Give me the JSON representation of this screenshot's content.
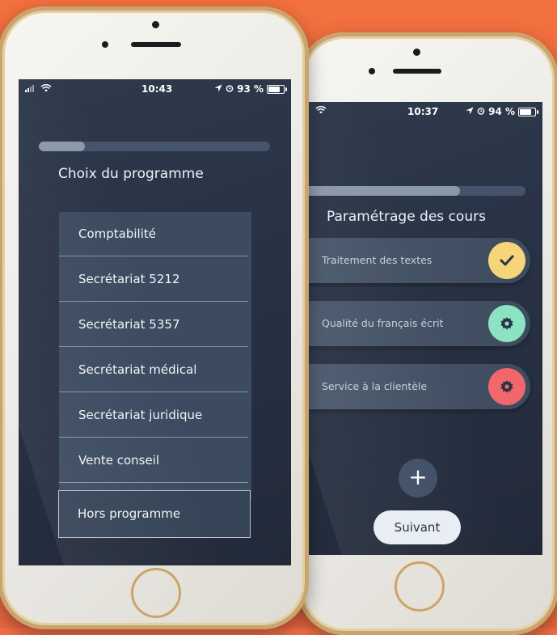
{
  "left_phone": {
    "status": {
      "time": "10:43",
      "battery": "93 %",
      "battery_level": 0.93
    },
    "progress": 0.2,
    "title": "Choix du programme",
    "programs": [
      "Comptabilité",
      "Secrétariat 5212",
      "Secrétariat 5357",
      "Secrétariat médical",
      "Secrétariat juridique",
      "Vente conseil"
    ],
    "other_program": "Hors programme"
  },
  "right_phone": {
    "status": {
      "time": "10:37",
      "battery": "94 %",
      "battery_level": 0.94
    },
    "progress": 0.7,
    "title": "Paramétrage des cours",
    "courses": [
      {
        "label": "Traitement des textes",
        "icon": "check-icon",
        "color": "#f6d57a"
      },
      {
        "label": "Qualité du français écrit",
        "icon": "gear-icon",
        "color": "#8be3c3"
      },
      {
        "label": "Service à la clientèle",
        "icon": "gear-icon",
        "color": "#f2676b"
      }
    ],
    "add_label": "+",
    "next_label": "Suivant"
  },
  "colors": {
    "background": "#f26f45",
    "screen": "#283244",
    "accent_light": "#e8eef4"
  }
}
